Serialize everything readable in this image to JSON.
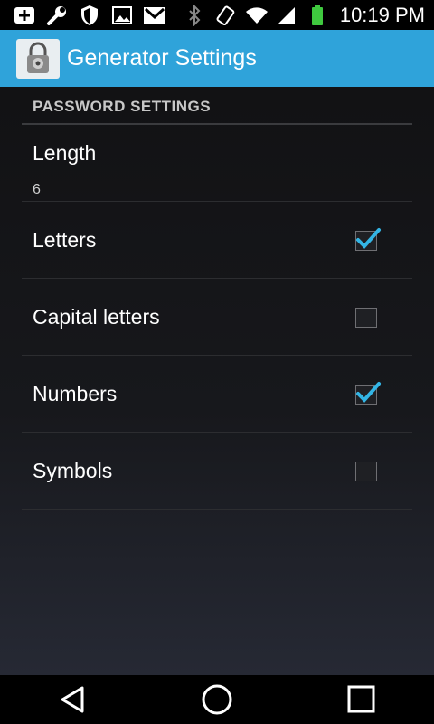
{
  "status_bar": {
    "time": "10:19 PM",
    "icons": [
      "plus-icon",
      "wrench-icon",
      "shield-icon",
      "image-icon",
      "gmail-icon",
      "bluetooth-icon",
      "vibrate-icon",
      "wifi-icon",
      "signal-icon",
      "battery-icon"
    ]
  },
  "action_bar": {
    "title": "Generator Settings",
    "app_icon": "lock-icon"
  },
  "section": {
    "header": "PASSWORD SETTINGS"
  },
  "preferences": [
    {
      "title": "Length",
      "summary": "6"
    },
    {
      "title": "Letters",
      "checked": true
    },
    {
      "title": "Capital letters",
      "checked": false
    },
    {
      "title": "Numbers",
      "checked": true
    },
    {
      "title": "Symbols",
      "checked": false
    }
  ],
  "nav_bar": {
    "icons": [
      "back-icon",
      "home-icon",
      "recents-icon"
    ]
  },
  "colors": {
    "accent": "#2fa3da",
    "check": "#33b5e5"
  }
}
